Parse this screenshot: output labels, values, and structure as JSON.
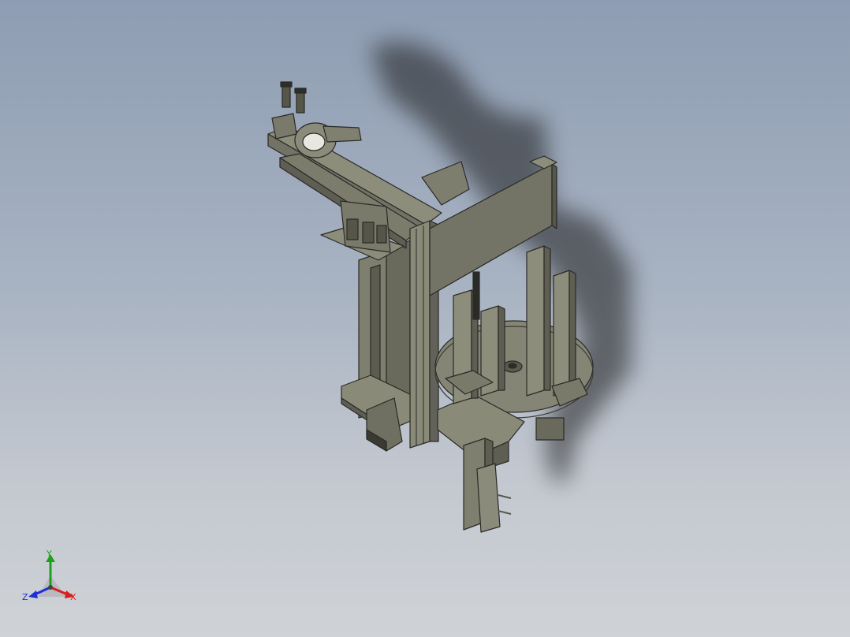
{
  "viewport": {
    "background_top": "#8e9db3",
    "background_bottom": "#cfd2d6",
    "model_color": "#7b7b6c",
    "model_edge_color": "#2a2a26"
  },
  "triad": {
    "y_label": "Y",
    "x_label": "X",
    "z_label": "Z",
    "y_color": "#1aa31a",
    "x_color": "#d81e1e",
    "z_color": "#1e2ed8"
  }
}
